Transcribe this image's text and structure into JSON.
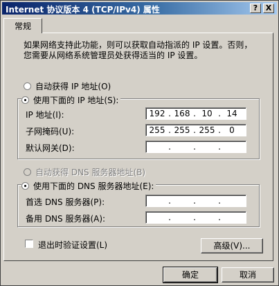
{
  "window": {
    "title": "Internet 协议版本 4 (TCP/IPv4) 属性",
    "help_label": "?",
    "close_label": "X"
  },
  "tabs": [
    {
      "label": "常规"
    }
  ],
  "description": "如果网络支持此功能，则可以获取自动指派的 IP 设置。否则，您需要从网络系统管理员处获得适当的 IP 设置。",
  "ip_section": {
    "auto_label": "自动获得 IP 地址(O)",
    "manual_label": "使用下面的 IP 地址(S):",
    "selected": "manual",
    "fields": [
      {
        "label": "IP 地址(I):",
        "value": [
          "192",
          "168",
          "10",
          "14"
        ]
      },
      {
        "label": "子网掩码(U):",
        "value": [
          "255",
          "255",
          "255",
          "0"
        ]
      },
      {
        "label": "默认网关(D):",
        "value": [
          "",
          "",
          "",
          ""
        ]
      }
    ]
  },
  "dns_section": {
    "auto_label": "自动获得 DNS 服务器地址(B)",
    "manual_label": "使用下面的 DNS 服务器地址(E):",
    "selected": "manual",
    "fields": [
      {
        "label": "首选 DNS 服务器(P):",
        "value": [
          "",
          "",
          "",
          ""
        ]
      },
      {
        "label": "备用 DNS 服务器(A):",
        "value": [
          "",
          "",
          "",
          ""
        ]
      }
    ]
  },
  "validate_label": "退出时验证设置(L)",
  "validate_checked": false,
  "advanced_label": "高级(V)...",
  "ok_label": "确定",
  "cancel_label": "取消"
}
